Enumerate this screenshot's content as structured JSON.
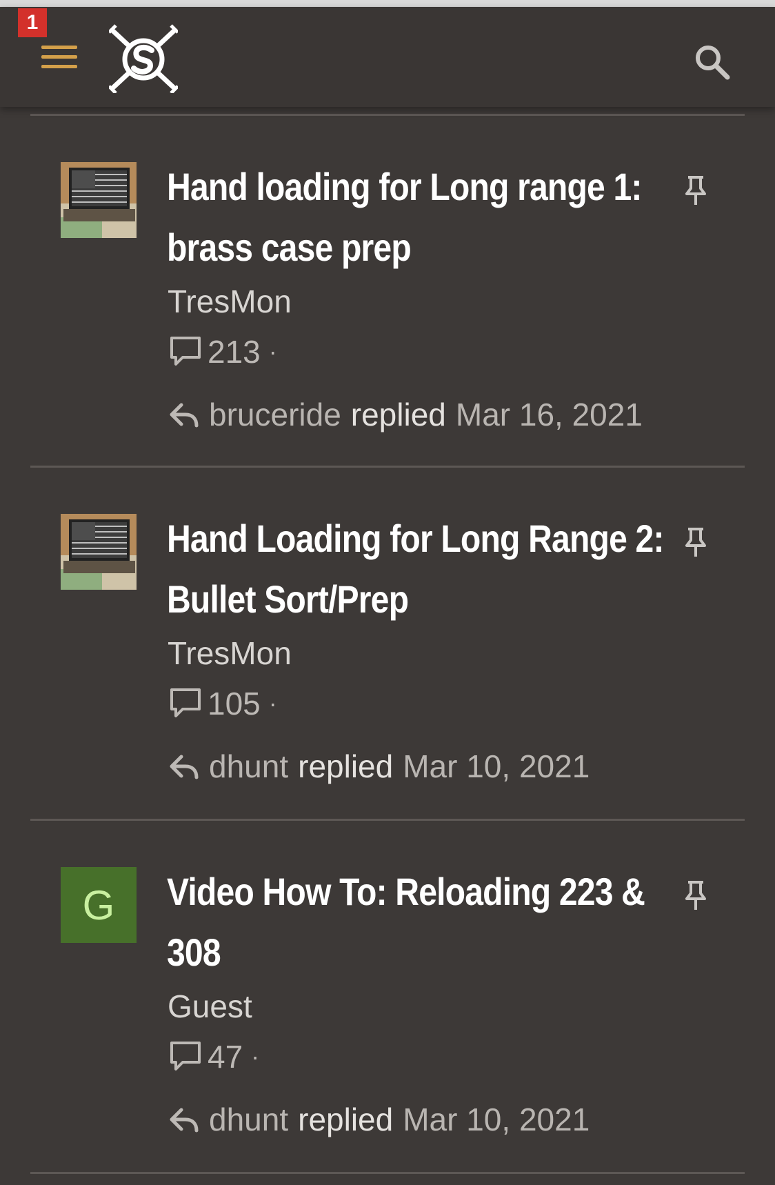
{
  "header": {
    "notification_count": "1",
    "menu_icon": "hamburger-menu-icon",
    "logo_icon": "site-logo-icon",
    "search_icon": "search-icon",
    "accent_color": "#d4a04a"
  },
  "threads": [
    {
      "title": "Hand loading for Long range 1: brass case prep",
      "author": "TresMon",
      "replies": "213",
      "last_poster": "bruceride",
      "action": "replied",
      "date": "Mar 16, 2021",
      "avatar": "usmc-flag-avatar",
      "pinned": true
    },
    {
      "title": "Hand Loading for Long Range 2: Bullet Sort/Prep",
      "author": "TresMon",
      "replies": "105",
      "last_poster": "dhunt",
      "action": "replied",
      "date": "Mar 10, 2021",
      "avatar": "usmc-flag-avatar",
      "pinned": true
    },
    {
      "title": "Video How To: Reloading 223 & 308",
      "author": "Guest",
      "replies": "47",
      "last_poster": "dhunt",
      "action": "replied",
      "date": "Mar 10, 2021",
      "avatar_letter": "G",
      "avatar_color": "#47702a",
      "pinned": true
    }
  ],
  "separator": "·"
}
